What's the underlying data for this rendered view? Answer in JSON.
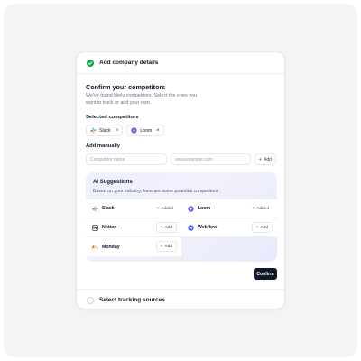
{
  "step_done": {
    "label": "Add company details"
  },
  "header": {
    "title": "Confirm your competitors",
    "description": "We've found likely competitors. Select the ones you want to track or add your own."
  },
  "selected": {
    "label": "Selected competitors",
    "chips": [
      {
        "name": "Slack",
        "icon": "slack-logo-icon"
      },
      {
        "name": "Loom",
        "icon": "loom-logo-icon"
      }
    ]
  },
  "manual": {
    "label": "Add manually",
    "name_placeholder": "Competitor name",
    "url_placeholder": "www.example.com",
    "add_label": "Add"
  },
  "ai": {
    "title": "AI Suggestions",
    "subtitle": "Based on your industry, here are some potential competitors:",
    "items": [
      {
        "name": "Slack",
        "action": "Added"
      },
      {
        "name": "Loom",
        "action": "Added"
      },
      {
        "name": "Notion",
        "action": "Add"
      },
      {
        "name": "Webflow",
        "action": "Add"
      },
      {
        "name": "Monday",
        "action": "Add"
      }
    ]
  },
  "confirm_label": "Confirm",
  "step_next": {
    "label": "Select tracking sources"
  },
  "colors": {
    "success": "#16a34a",
    "primary_button": "#111827",
    "ai_bg": "#eef0fd"
  }
}
